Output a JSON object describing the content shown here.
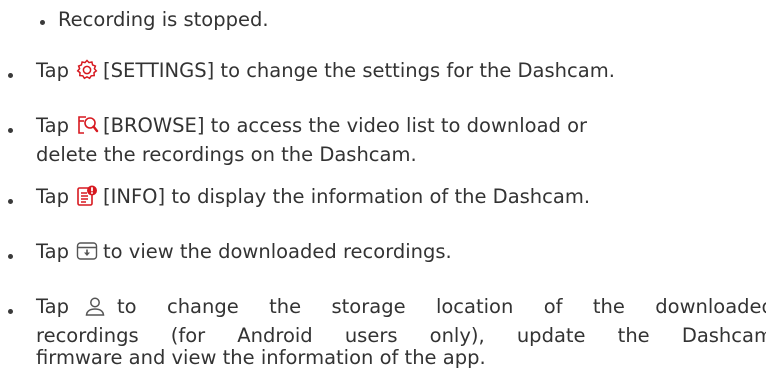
{
  "colors": {
    "text": "#333333",
    "icon_red": "#d71920",
    "icon_gray": "#555555"
  },
  "items": [
    {
      "line1": "Recording is stopped."
    },
    {
      "tap": "Tap",
      "icon": "settings-icon",
      "line1": "[SETTINGS] to change the settings for the Dashcam."
    },
    {
      "tap": "Tap",
      "icon": "browse-icon",
      "line1": "[BROWSE] to access the video list to download or",
      "line2": "delete the recordings on the Dashcam."
    },
    {
      "tap": "Tap",
      "icon": "info-icon",
      "line1": "[INFO] to display the information of the Dashcam."
    },
    {
      "tap": "Tap",
      "icon": "downloads-icon",
      "line1": "to view the downloaded recordings."
    },
    {
      "tap": "Tap",
      "icon": "user-icon",
      "line1_words": [
        "to",
        "change",
        "the",
        "storage",
        "location",
        "of",
        "the",
        "downloaded"
      ],
      "line2_words": [
        "recordings",
        "(for",
        "Android",
        "users",
        "only),",
        "update",
        "the",
        "Dashcam"
      ],
      "line3": "firmware and view the information of the app."
    }
  ]
}
